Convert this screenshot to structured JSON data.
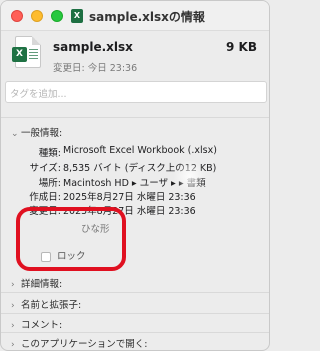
{
  "window": {
    "title": "sample.xlsxの情報"
  },
  "header": {
    "file_badge": "X",
    "file_name": "sample.xlsx",
    "file_size": "9 KB",
    "modified": "変更日: 今日 23:36"
  },
  "tags": {
    "placeholder": "タグを追加..."
  },
  "general": {
    "label": "一般情報:",
    "rows": [
      {
        "key": "種類:",
        "value": "Microsoft Excel Workbook (.xlsx)"
      },
      {
        "key": "サイズ:",
        "value": "8,535 バイト (ディスク上の12 KB)"
      },
      {
        "key": "場所:",
        "value": "Macintosh HD ▸ ユーザ ▸       ▸ 書類"
      },
      {
        "key": "作成日:",
        "value": "2025年8月27日 水曜日 23:36"
      },
      {
        "key": "変更日:",
        "value": "2025年8月27日 水曜日 23:36"
      }
    ],
    "stationery_partial": "ひな形",
    "lock_label": "ロック"
  },
  "sections": [
    {
      "label": "詳細情報:"
    },
    {
      "label": "名前と拡張子:"
    },
    {
      "label": "コメント:"
    },
    {
      "label": "このアプリケーションで開く:"
    }
  ],
  "colors": {
    "highlight": "#e01020",
    "excel_green": "#1f7244"
  }
}
